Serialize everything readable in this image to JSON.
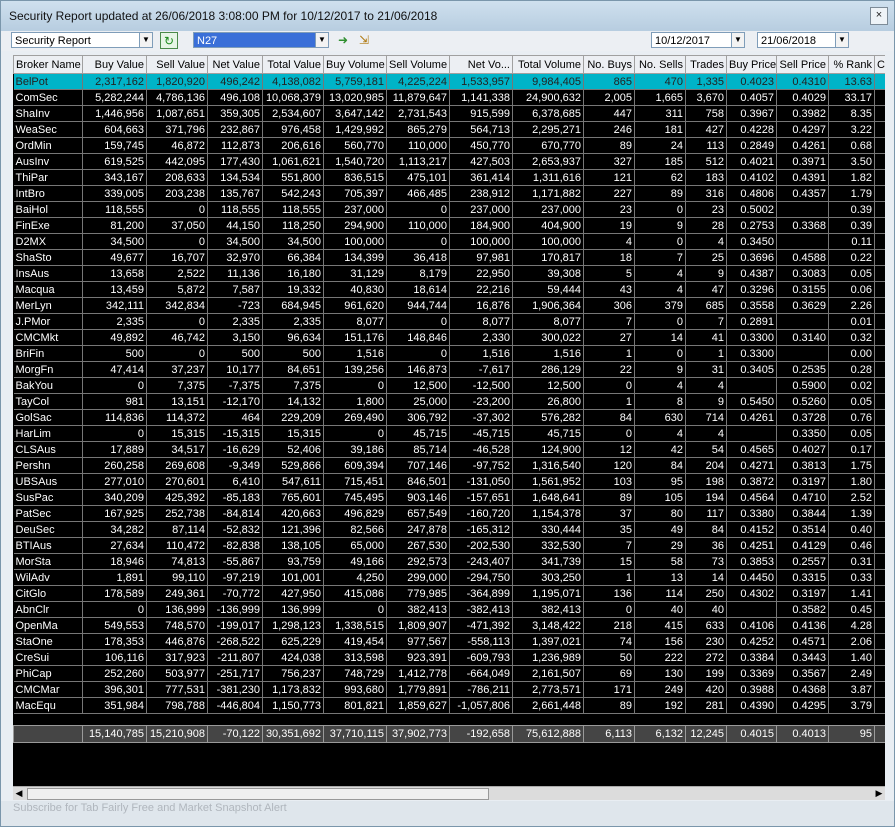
{
  "window": {
    "title": "Security Report updated at 26/06/2018 3:08:00 PM for 10/12/2017 to 21/06/2018",
    "close_glyph": "×"
  },
  "toolbar": {
    "report_type": "Security Report",
    "security_code": "N27",
    "date_from": "10/12/2017",
    "date_to": "21/06/2018"
  },
  "table": {
    "columns": [
      "Broker Name",
      "Buy Value",
      "Sell Value",
      "Net Value",
      "Total Value",
      "Buy Volume",
      "Sell Volume",
      "Net Vo...",
      "Total Volume",
      "No. Buys",
      "No. Sells",
      "Trades",
      "Buy Price",
      "Sell Price",
      "% Rank",
      "C"
    ],
    "rows": [
      [
        "BelPot",
        "2,317,162",
        "1,820,920",
        "496,242",
        "4,138,082",
        "5,759,181",
        "4,225,224",
        "1,533,957",
        "9,984,405",
        "865",
        "470",
        "1,335",
        "0.4023",
        "0.4310",
        "13.63"
      ],
      [
        "ComSec",
        "5,282,244",
        "4,786,136",
        "496,108",
        "10,068,379",
        "13,020,985",
        "11,879,647",
        "1,141,338",
        "24,900,632",
        "2,005",
        "1,665",
        "3,670",
        "0.4057",
        "0.4029",
        "33.17"
      ],
      [
        "ShaInv",
        "1,446,956",
        "1,087,651",
        "359,305",
        "2,534,607",
        "3,647,142",
        "2,731,543",
        "915,599",
        "6,378,685",
        "447",
        "311",
        "758",
        "0.3967",
        "0.3982",
        "8.35"
      ],
      [
        "WeaSec",
        "604,663",
        "371,796",
        "232,867",
        "976,458",
        "1,429,992",
        "865,279",
        "564,713",
        "2,295,271",
        "246",
        "181",
        "427",
        "0.4228",
        "0.4297",
        "3.22"
      ],
      [
        "OrdMin",
        "159,745",
        "46,872",
        "112,873",
        "206,616",
        "560,770",
        "110,000",
        "450,770",
        "670,770",
        "89",
        "24",
        "113",
        "0.2849",
        "0.4261",
        "0.68"
      ],
      [
        "AusInv",
        "619,525",
        "442,095",
        "177,430",
        "1,061,621",
        "1,540,720",
        "1,113,217",
        "427,503",
        "2,653,937",
        "327",
        "185",
        "512",
        "0.4021",
        "0.3971",
        "3.50"
      ],
      [
        "ThiPar",
        "343,167",
        "208,633",
        "134,534",
        "551,800",
        "836,515",
        "475,101",
        "361,414",
        "1,311,616",
        "121",
        "62",
        "183",
        "0.4102",
        "0.4391",
        "1.82"
      ],
      [
        "IntBro",
        "339,005",
        "203,238",
        "135,767",
        "542,243",
        "705,397",
        "466,485",
        "238,912",
        "1,171,882",
        "227",
        "89",
        "316",
        "0.4806",
        "0.4357",
        "1.79"
      ],
      [
        "BaiHol",
        "118,555",
        "0",
        "118,555",
        "118,555",
        "237,000",
        "0",
        "237,000",
        "237,000",
        "23",
        "0",
        "23",
        "0.5002",
        "",
        "0.39"
      ],
      [
        "FinExe",
        "81,200",
        "37,050",
        "44,150",
        "118,250",
        "294,900",
        "110,000",
        "184,900",
        "404,900",
        "19",
        "9",
        "28",
        "0.2753",
        "0.3368",
        "0.39"
      ],
      [
        "D2MX",
        "34,500",
        "0",
        "34,500",
        "34,500",
        "100,000",
        "0",
        "100,000",
        "100,000",
        "4",
        "0",
        "4",
        "0.3450",
        "",
        "0.11"
      ],
      [
        "ShaSto",
        "49,677",
        "16,707",
        "32,970",
        "66,384",
        "134,399",
        "36,418",
        "97,981",
        "170,817",
        "18",
        "7",
        "25",
        "0.3696",
        "0.4588",
        "0.22"
      ],
      [
        "InsAus",
        "13,658",
        "2,522",
        "11,136",
        "16,180",
        "31,129",
        "8,179",
        "22,950",
        "39,308",
        "5",
        "4",
        "9",
        "0.4387",
        "0.3083",
        "0.05"
      ],
      [
        "Macqua",
        "13,459",
        "5,872",
        "7,587",
        "19,332",
        "40,830",
        "18,614",
        "22,216",
        "59,444",
        "43",
        "4",
        "47",
        "0.3296",
        "0.3155",
        "0.06"
      ],
      [
        "MerLyn",
        "342,111",
        "342,834",
        "-723",
        "684,945",
        "961,620",
        "944,744",
        "16,876",
        "1,906,364",
        "306",
        "379",
        "685",
        "0.3558",
        "0.3629",
        "2.26"
      ],
      [
        "J.PMor",
        "2,335",
        "0",
        "2,335",
        "2,335",
        "8,077",
        "0",
        "8,077",
        "8,077",
        "7",
        "0",
        "7",
        "0.2891",
        "",
        "0.01"
      ],
      [
        "CMCMkt",
        "49,892",
        "46,742",
        "3,150",
        "96,634",
        "151,176",
        "148,846",
        "2,330",
        "300,022",
        "27",
        "14",
        "41",
        "0.3300",
        "0.3140",
        "0.32"
      ],
      [
        "BriFin",
        "500",
        "0",
        "500",
        "500",
        "1,516",
        "0",
        "1,516",
        "1,516",
        "1",
        "0",
        "1",
        "0.3300",
        "",
        "0.00"
      ],
      [
        "MorgFn",
        "47,414",
        "37,237",
        "10,177",
        "84,651",
        "139,256",
        "146,873",
        "-7,617",
        "286,129",
        "22",
        "9",
        "31",
        "0.3405",
        "0.2535",
        "0.28"
      ],
      [
        "BakYou",
        "0",
        "7,375",
        "-7,375",
        "7,375",
        "0",
        "12,500",
        "-12,500",
        "12,500",
        "0",
        "4",
        "4",
        "",
        "0.5900",
        "0.02"
      ],
      [
        "TayCol",
        "981",
        "13,151",
        "-12,170",
        "14,132",
        "1,800",
        "25,000",
        "-23,200",
        "26,800",
        "1",
        "8",
        "9",
        "0.5450",
        "0.5260",
        "0.05"
      ],
      [
        "GolSac",
        "114,836",
        "114,372",
        "464",
        "229,209",
        "269,490",
        "306,792",
        "-37,302",
        "576,282",
        "84",
        "630",
        "714",
        "0.4261",
        "0.3728",
        "0.76"
      ],
      [
        "HarLim",
        "0",
        "15,315",
        "-15,315",
        "15,315",
        "0",
        "45,715",
        "-45,715",
        "45,715",
        "0",
        "4",
        "4",
        "",
        "0.3350",
        "0.05"
      ],
      [
        "CLSAus",
        "17,889",
        "34,517",
        "-16,629",
        "52,406",
        "39,186",
        "85,714",
        "-46,528",
        "124,900",
        "12",
        "42",
        "54",
        "0.4565",
        "0.4027",
        "0.17"
      ],
      [
        "Pershn",
        "260,258",
        "269,608",
        "-9,349",
        "529,866",
        "609,394",
        "707,146",
        "-97,752",
        "1,316,540",
        "120",
        "84",
        "204",
        "0.4271",
        "0.3813",
        "1.75"
      ],
      [
        "UBSAus",
        "277,010",
        "270,601",
        "6,410",
        "547,611",
        "715,451",
        "846,501",
        "-131,050",
        "1,561,952",
        "103",
        "95",
        "198",
        "0.3872",
        "0.3197",
        "1.80"
      ],
      [
        "SusPac",
        "340,209",
        "425,392",
        "-85,183",
        "765,601",
        "745,495",
        "903,146",
        "-157,651",
        "1,648,641",
        "89",
        "105",
        "194",
        "0.4564",
        "0.4710",
        "2.52"
      ],
      [
        "PatSec",
        "167,925",
        "252,738",
        "-84,814",
        "420,663",
        "496,829",
        "657,549",
        "-160,720",
        "1,154,378",
        "37",
        "80",
        "117",
        "0.3380",
        "0.3844",
        "1.39"
      ],
      [
        "DeuSec",
        "34,282",
        "87,114",
        "-52,832",
        "121,396",
        "82,566",
        "247,878",
        "-165,312",
        "330,444",
        "35",
        "49",
        "84",
        "0.4152",
        "0.3514",
        "0.40"
      ],
      [
        "BTIAus",
        "27,634",
        "110,472",
        "-82,838",
        "138,105",
        "65,000",
        "267,530",
        "-202,530",
        "332,530",
        "7",
        "29",
        "36",
        "0.4251",
        "0.4129",
        "0.46"
      ],
      [
        "MorSta",
        "18,946",
        "74,813",
        "-55,867",
        "93,759",
        "49,166",
        "292,573",
        "-243,407",
        "341,739",
        "15",
        "58",
        "73",
        "0.3853",
        "0.2557",
        "0.31"
      ],
      [
        "WilAdv",
        "1,891",
        "99,110",
        "-97,219",
        "101,001",
        "4,250",
        "299,000",
        "-294,750",
        "303,250",
        "1",
        "13",
        "14",
        "0.4450",
        "0.3315",
        "0.33"
      ],
      [
        "CitGlo",
        "178,589",
        "249,361",
        "-70,772",
        "427,950",
        "415,086",
        "779,985",
        "-364,899",
        "1,195,071",
        "136",
        "114",
        "250",
        "0.4302",
        "0.3197",
        "1.41"
      ],
      [
        "AbnClr",
        "0",
        "136,999",
        "-136,999",
        "136,999",
        "0",
        "382,413",
        "-382,413",
        "382,413",
        "0",
        "40",
        "40",
        "",
        "0.3582",
        "0.45"
      ],
      [
        "OpenMa",
        "549,553",
        "748,570",
        "-199,017",
        "1,298,123",
        "1,338,515",
        "1,809,907",
        "-471,392",
        "3,148,422",
        "218",
        "415",
        "633",
        "0.4106",
        "0.4136",
        "4.28"
      ],
      [
        "StaOne",
        "178,353",
        "446,876",
        "-268,522",
        "625,229",
        "419,454",
        "977,567",
        "-558,113",
        "1,397,021",
        "74",
        "156",
        "230",
        "0.4252",
        "0.4571",
        "2.06"
      ],
      [
        "CreSui",
        "106,116",
        "317,923",
        "-211,807",
        "424,038",
        "313,598",
        "923,391",
        "-609,793",
        "1,236,989",
        "50",
        "222",
        "272",
        "0.3384",
        "0.3443",
        "1.40"
      ],
      [
        "PhiCap",
        "252,260",
        "503,977",
        "-251,717",
        "756,237",
        "748,729",
        "1,412,778",
        "-664,049",
        "2,161,507",
        "69",
        "130",
        "199",
        "0.3369",
        "0.3567",
        "2.49"
      ],
      [
        "CMCMar",
        "396,301",
        "777,531",
        "-381,230",
        "1,173,832",
        "993,680",
        "1,779,891",
        "-786,211",
        "2,773,571",
        "171",
        "249",
        "420",
        "0.3988",
        "0.4368",
        "3.87"
      ],
      [
        "MacEqu",
        "351,984",
        "798,788",
        "-446,804",
        "1,150,773",
        "801,821",
        "1,859,627",
        "-1,057,806",
        "2,661,448",
        "89",
        "192",
        "281",
        "0.4390",
        "0.4295",
        "3.79"
      ]
    ],
    "totals": [
      "",
      "15,140,785",
      "15,210,908",
      "-70,122",
      "30,351,692",
      "37,710,115",
      "37,902,773",
      "-192,658",
      "75,612,888",
      "6,113",
      "6,132",
      "12,245",
      "0.4015",
      "0.4013",
      "95",
      ""
    ]
  },
  "scroll": {
    "left_arrow": "◀",
    "right_arrow": "▶"
  },
  "status": {
    "text": "Subscribe for Tab Fairly Free and Market Snapshot Alert"
  },
  "colors": {
    "grid_bg": "#000000",
    "selected_row": "#00b4c8",
    "header_bg": "#eceff3"
  },
  "icons": [
    "dropdown-arrow-icon",
    "refresh-icon",
    "go-arrow-icon",
    "export-icon",
    "calendar-dropdown-icon"
  ]
}
